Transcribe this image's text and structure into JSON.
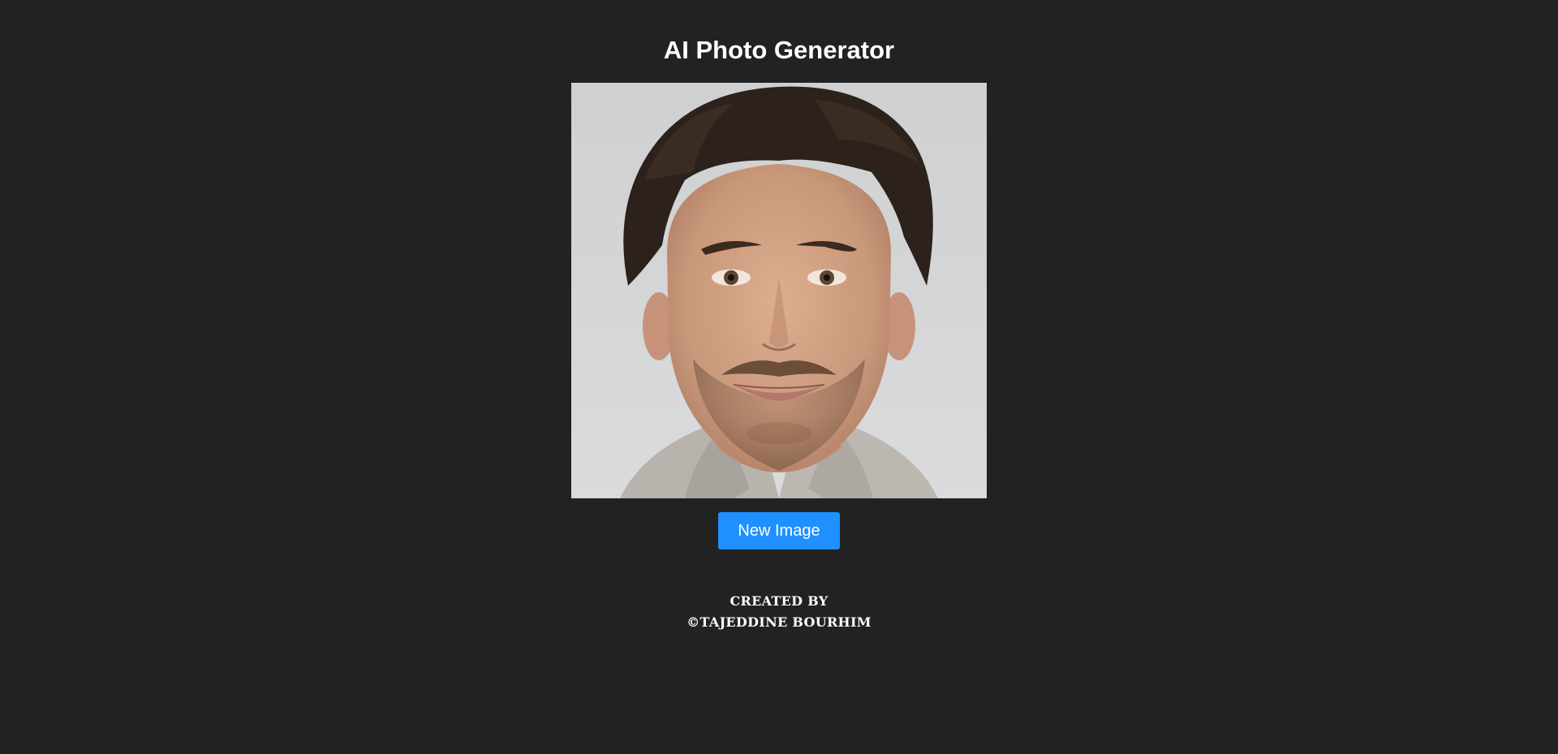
{
  "page": {
    "title": "AI Photo Generator"
  },
  "photo": {
    "icon": "generated-portrait-image"
  },
  "actions": {
    "new_image_label": "New Image"
  },
  "footer": {
    "line1": "CREATED BY",
    "line2": "©TAJEDDINE BOURHIM"
  },
  "colors": {
    "background": "#222222",
    "button": "#1e90ff",
    "text": "#ffffff"
  }
}
